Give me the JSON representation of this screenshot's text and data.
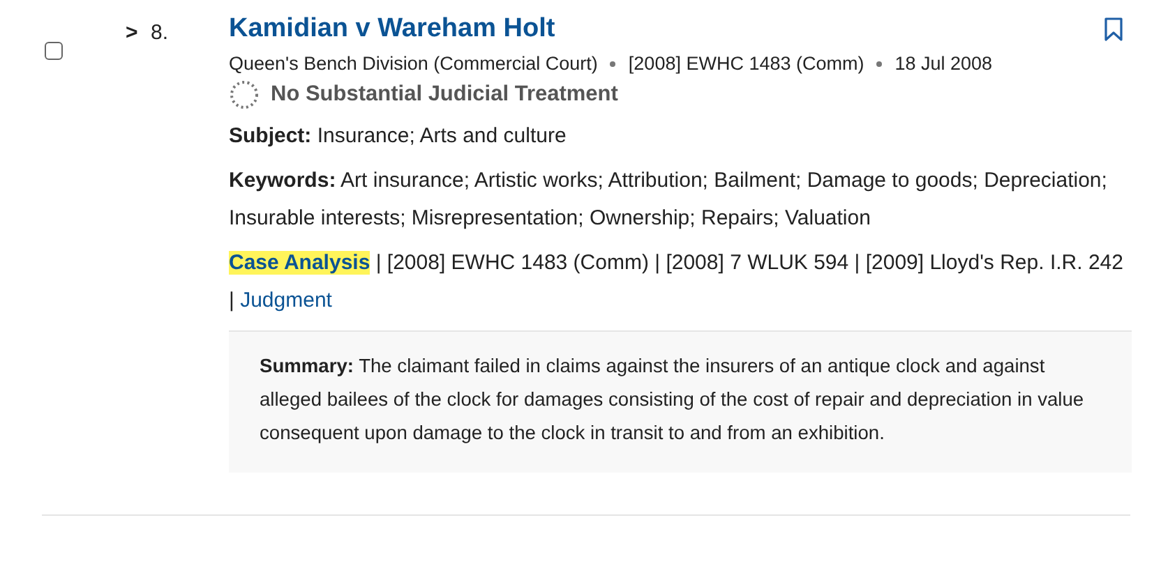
{
  "result": {
    "checked": false,
    "expanded": false,
    "chevron": ">",
    "number": "8.",
    "title": "Kamidian v Wareham Holt",
    "bookmarked": false,
    "meta": [
      "Queen's Bench Division (Commercial Court)",
      "[2008] EWHC 1483 (Comm)",
      "18 Jul 2008"
    ],
    "treatment": "No Substantial Judicial Treatment",
    "subject": "**Subject:** Insurance; Arts and culture",
    "keywords": "**Keywords:** Art insurance; Artistic works; Attribution; Bailment; Damage to goods; Depreciation; Insurable interests; Misrepresentation; Ownership; Repairs; Valuation",
    "citations": [
      {
        "kind": "link",
        "text": "Case Analysis",
        "highlighted": true
      },
      {
        "kind": "text",
        "text": " | [2008] EWHC 1483 (Comm) | [2008] 7 WLUK 594 | [2009] Lloyd's Rep. I.R. 242 | "
      },
      {
        "kind": "link",
        "text": "Judgment",
        "highlighted": false
      }
    ],
    "summary": "**Summary:** The claimant failed in claims against the insurers of an antique clock and against alleged bailees of the clock for damages consisting of the cost of repair and depreciation in value consequent upon damage to the clock in transit to and from an exhibition."
  }
}
